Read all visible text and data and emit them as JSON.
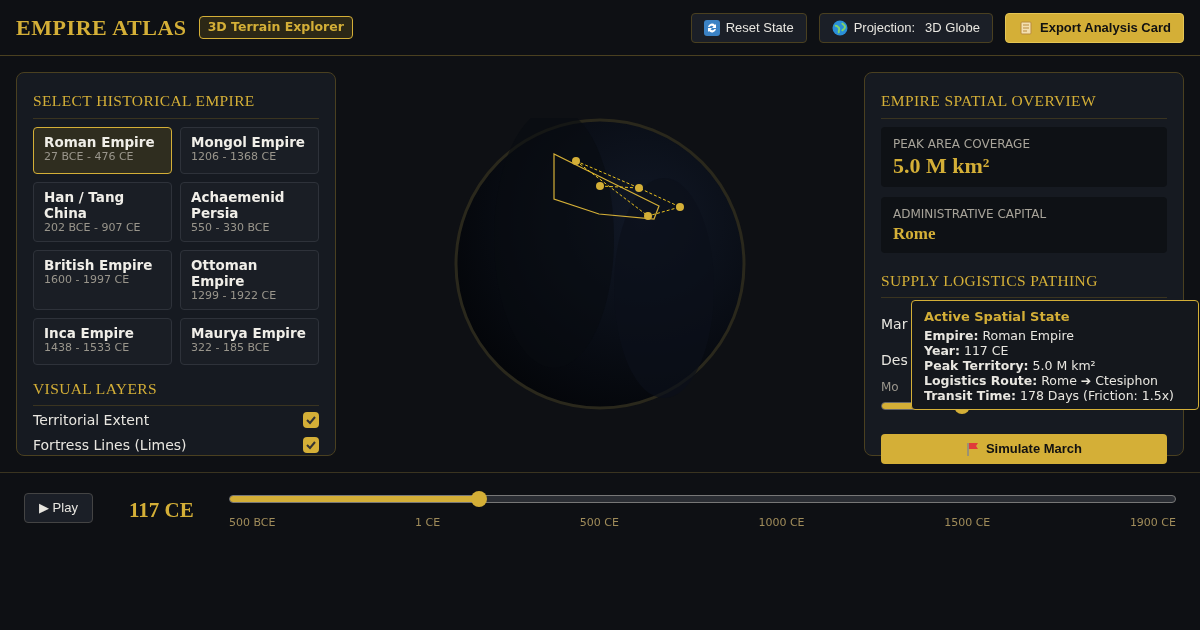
{
  "header": {
    "title": "EMPIRE ATLAS",
    "badge": "3D Terrain Explorer",
    "buttons": [
      {
        "kind": "reset",
        "label": "Reset State"
      },
      {
        "kind": "projection",
        "label": "Projection:",
        "value": "3D Globe"
      },
      {
        "kind": "export",
        "label": "Export Analysis Card"
      }
    ]
  },
  "left_panel": {
    "title": "SELECT HISTORICAL EMPIRE",
    "empires": [
      {
        "name": "Roman Empire",
        "dates": "27 BCE - 476 CE",
        "selected": true
      },
      {
        "name": "Mongol Empire",
        "dates": "1206 - 1368 CE",
        "selected": false
      },
      {
        "name": "Han / Tang China",
        "dates": "202 BCE - 907 CE",
        "selected": false
      },
      {
        "name": "Achaemenid Persia",
        "dates": "550 - 330 BCE",
        "selected": false
      },
      {
        "name": "British Empire",
        "dates": "1600 - 1997 CE",
        "selected": false
      },
      {
        "name": "Ottoman Empire",
        "dates": "1299 - 1922 CE",
        "selected": false
      },
      {
        "name": "Inca Empire",
        "dates": "1438 - 1533 CE",
        "selected": false
      },
      {
        "name": "Maurya Empire",
        "dates": "322 - 185 BCE",
        "selected": false
      }
    ],
    "layers_title": "VISUAL LAYERS",
    "layers": [
      {
        "label": "Territorial Extent",
        "checked": true
      },
      {
        "label": "Fortress Lines (Limes)",
        "checked": true
      }
    ]
  },
  "right_panel": {
    "title": "EMPIRE SPATIAL OVERVIEW",
    "stats": [
      {
        "label": "PEAK AREA COVERAGE",
        "value": "5.0 M km²",
        "kind": "large"
      },
      {
        "label": "ADMINISTRATIVE CAPITAL",
        "value": "Rome",
        "kind": "medium"
      }
    ],
    "logistics_title": "SUPPLY LOGISTICS PATHING",
    "origin_label": "Mar",
    "destination_label": "Des",
    "friction_label": "Mo",
    "friction": {
      "level": 0.28
    },
    "simulate_button": "Simulate March"
  },
  "tooltip": {
    "title": "Active Spatial State",
    "rows": [
      {
        "key": "Empire:",
        "value": "Roman Empire"
      },
      {
        "key": "Year:",
        "value": "117 CE"
      },
      {
        "key": "Peak Territory:",
        "value": "5.0 M km²"
      },
      {
        "key": "Logistics Route:",
        "value": "Rome ➔ Ctesiphon"
      },
      {
        "key": "Transit Time:",
        "value": "178 Days (Friction: 1.5x)"
      }
    ]
  },
  "timeline": {
    "play_button": "▶ Play",
    "year": "117 CE",
    "level": 0.264,
    "ticks": [
      "500 BCE",
      "1 CE",
      "500 CE",
      "1000 CE",
      "1500 CE",
      "1900 CE"
    ]
  }
}
